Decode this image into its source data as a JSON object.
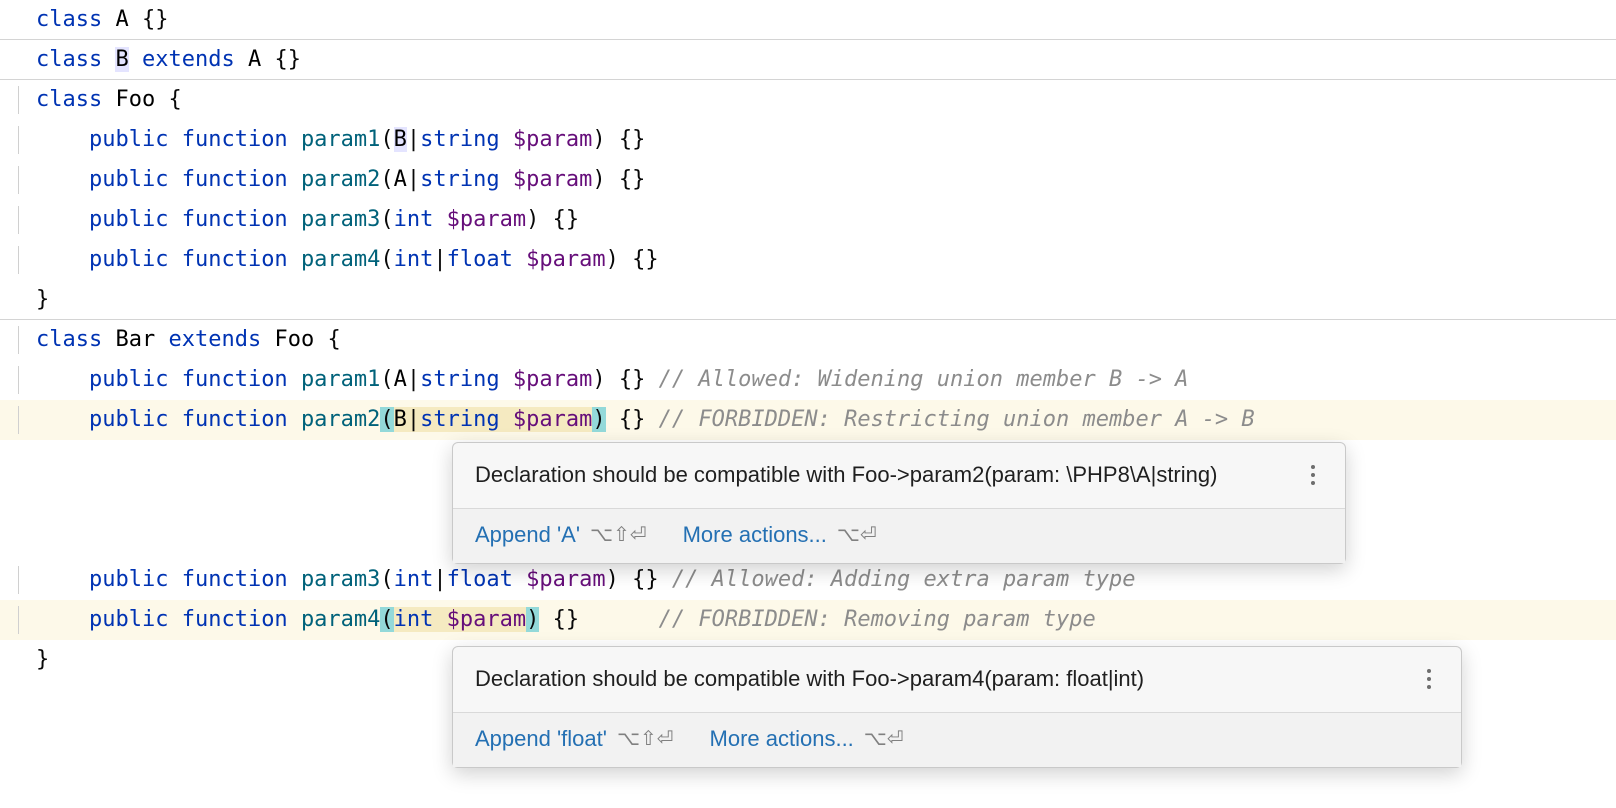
{
  "code": {
    "l1": {
      "kw1": "class",
      "name": "A",
      "rest": " {}"
    },
    "l2": {
      "kw1": "class",
      "name": "B",
      "kw2": "extends",
      "parent": "A",
      "rest": " {}"
    },
    "l3": {
      "kw1": "class",
      "name": "Foo",
      "brace": " {"
    },
    "l4": {
      "vis": "public",
      "kw": "function",
      "fn": "param1",
      "open": "(",
      "t1": "B",
      "pipe": "|",
      "t2": "string",
      "var": "$param",
      "close": ") {}"
    },
    "l5": {
      "vis": "public",
      "kw": "function",
      "fn": "param2",
      "open": "(",
      "t1": "A",
      "pipe": "|",
      "t2": "string",
      "var": "$param",
      "close": ") {}"
    },
    "l6": {
      "vis": "public",
      "kw": "function",
      "fn": "param3",
      "open": "(",
      "t1": "int",
      "var": "$param",
      "close": ") {}"
    },
    "l7": {
      "vis": "public",
      "kw": "function",
      "fn": "param4",
      "open": "(",
      "t1": "int",
      "pipe": "|",
      "t2": "float",
      "var": "$param",
      "close": ") {}"
    },
    "l8": {
      "brace": "}"
    },
    "l9": {
      "kw1": "class",
      "name": "Bar",
      "kw2": "extends",
      "parent": "Foo",
      "brace": " {"
    },
    "l10": {
      "vis": "public",
      "kw": "function",
      "fn": "param1",
      "open": "(",
      "t1": "A",
      "pipe": "|",
      "t2": "string",
      "var": "$param",
      "close": ") {}",
      "comment": "// Allowed: Widening union member B -> A"
    },
    "l11": {
      "vis": "public",
      "kw": "function",
      "fn": "param2",
      "open": "(",
      "t1": "B",
      "pipe": "|",
      "t2": "string",
      "var": "$param",
      "close": ")",
      "rest": " {}",
      "comment": "// FORBIDDEN: Restricting union member A -> B"
    },
    "l12": {
      "vis": "public",
      "kw": "function",
      "fn": "param3",
      "open": "(",
      "t1": "int",
      "pipe": "|",
      "t2": "float",
      "var": "$param",
      "close": ") {}",
      "comment": "// Allowed: Adding extra param type"
    },
    "l13": {
      "vis": "public",
      "kw": "function",
      "fn": "param4",
      "open": "(",
      "t1": "int",
      "var": "$param",
      "close": ")",
      "rest": " {}",
      "comment": "// FORBIDDEN: Removing param type"
    },
    "l14": {
      "brace": "}"
    }
  },
  "popup1": {
    "msg": "Declaration should be compatible with Foo->param2(param: \\PHP8\\A|string)",
    "fix": "Append 'A'",
    "fix_shortcut": "⌥⇧⏎",
    "more": "More actions...",
    "more_shortcut": "⌥⏎"
  },
  "popup2": {
    "msg": "Declaration should be compatible with Foo->param4(param: float|int)",
    "fix": "Append 'float'",
    "fix_shortcut": "⌥⇧⏎",
    "more": "More actions...",
    "more_shortcut": "⌥⏎"
  }
}
